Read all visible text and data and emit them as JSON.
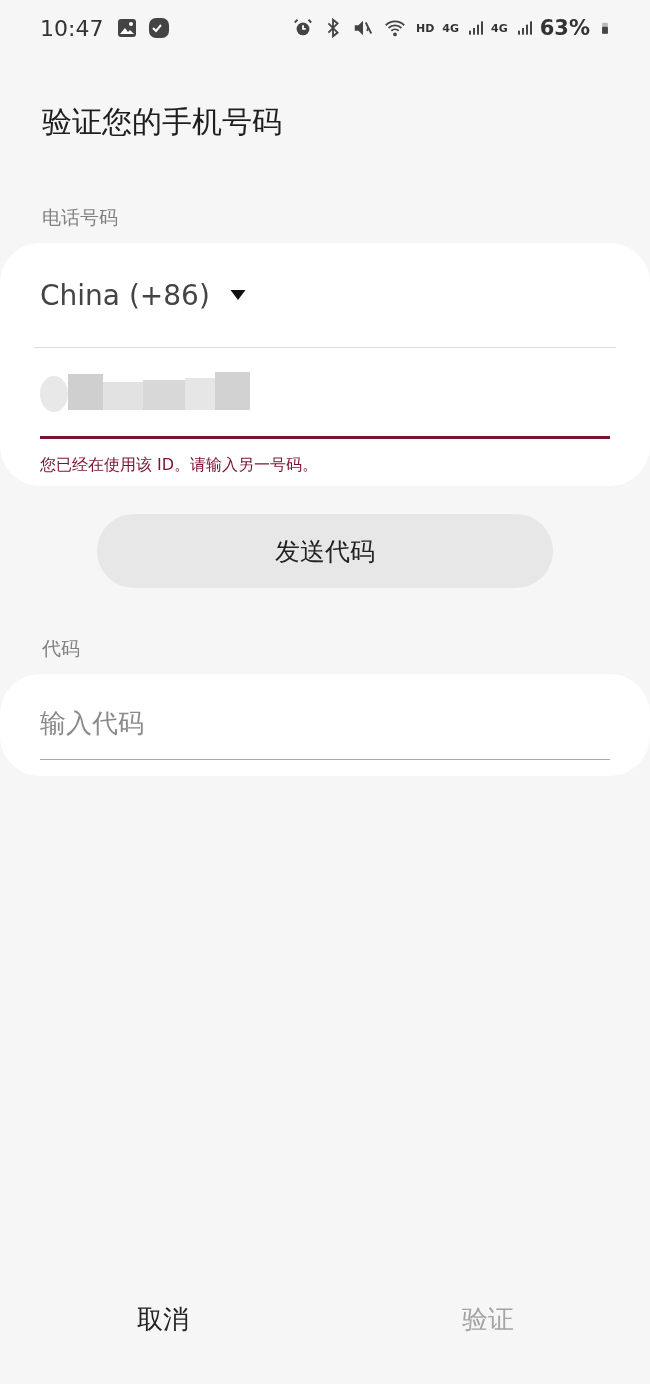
{
  "status_bar": {
    "time": "10:47",
    "network_labels": [
      "HD",
      "4G",
      "4G"
    ],
    "battery": "63%"
  },
  "title": "验证您的手机号码",
  "phone": {
    "label": "电话号码",
    "country": "China (+86)",
    "error": "您已经在使用该 ID。请输入另一号码。"
  },
  "send_button": {
    "label": "发送代码",
    "disabled": false
  },
  "code": {
    "label": "代码",
    "placeholder": "输入代码"
  },
  "actions": [
    {
      "label": "取消",
      "disabled": false
    },
    {
      "label": "验证",
      "disabled": true
    }
  ]
}
